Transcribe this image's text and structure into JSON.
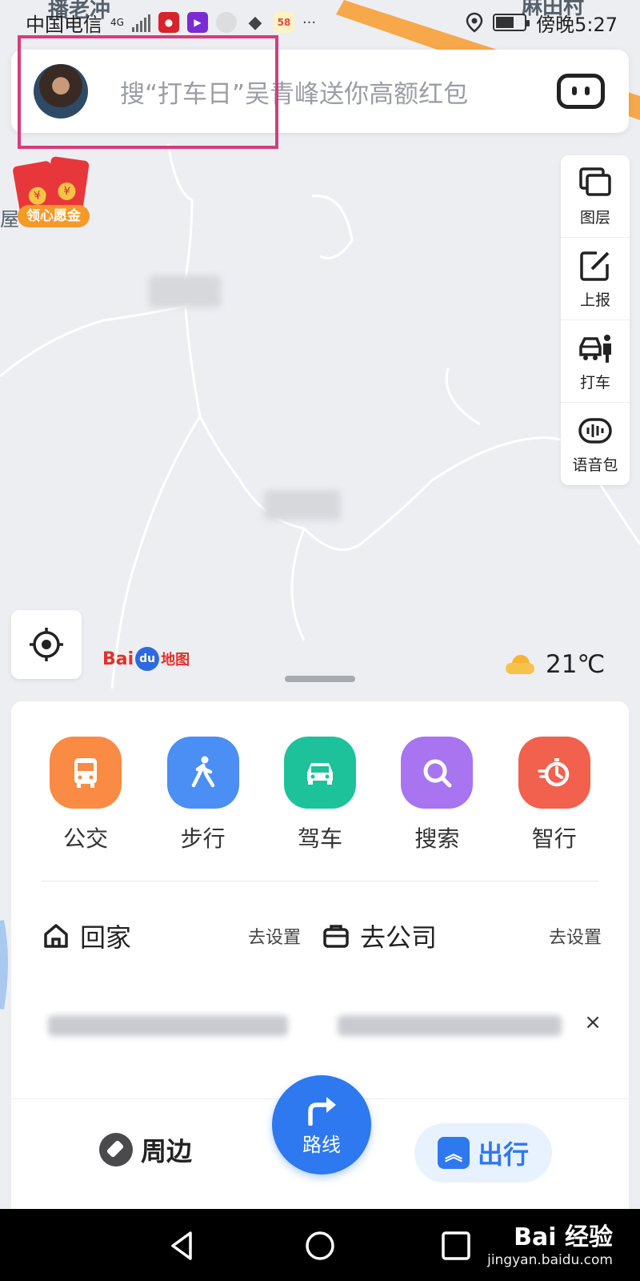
{
  "status_bar": {
    "carrier": "中国电信",
    "network": "4G",
    "time": "傍晚5:27"
  },
  "map": {
    "labels": [
      "播老冲",
      "麻田村",
      "屋"
    ]
  },
  "search": {
    "placeholder": "搜“打车日”吴青峰送你高额红包"
  },
  "red_packet": {
    "label": "领心愿金"
  },
  "tools": [
    {
      "label": "图层",
      "icon": "layers-icon"
    },
    {
      "label": "上报",
      "icon": "edit-report-icon"
    },
    {
      "label": "打车",
      "icon": "taxi-icon"
    },
    {
      "label": "语音包",
      "icon": "voice-pack-icon"
    }
  ],
  "logo": {
    "bai": "Bai",
    "du": "du",
    "ditu": "地图"
  },
  "weather": {
    "temperature": "21℃",
    "icon": "partly-cloudy-icon"
  },
  "modes": [
    {
      "label": "公交",
      "color": "#f98b44",
      "icon": "bus-icon"
    },
    {
      "label": "步行",
      "color": "#4b8ff4",
      "icon": "walk-icon"
    },
    {
      "label": "驾车",
      "color": "#1ec29a",
      "icon": "car-icon"
    },
    {
      "label": "搜索",
      "color": "#a874f0",
      "icon": "search-icon"
    },
    {
      "label": "智行",
      "color": "#f2604e",
      "icon": "smart-travel-icon"
    }
  ],
  "shortcuts": [
    {
      "name": "回家",
      "action": "去设置",
      "icon": "home-icon"
    },
    {
      "name": "去公司",
      "action": "去设置",
      "icon": "briefcase-icon"
    }
  ],
  "history": {
    "close": "×"
  },
  "tabbar": {
    "nearby": "周边",
    "route": "路线",
    "go": "出行"
  },
  "watermark": {
    "logo": "Bai 经验",
    "url": "jingyan.baidu.com"
  }
}
